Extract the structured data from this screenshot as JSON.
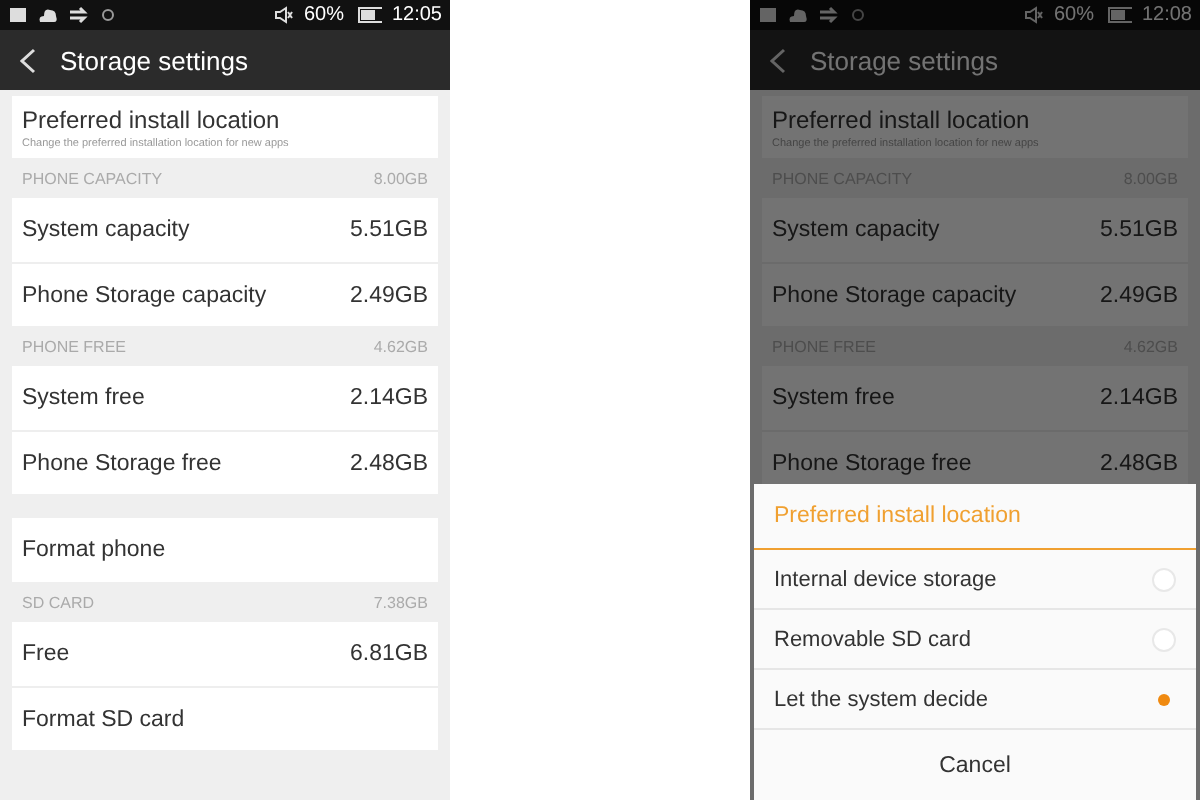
{
  "screens": [
    {
      "status_bar": {
        "battery": "60%",
        "time": "12:05"
      },
      "title": "Storage settings",
      "blocks": [
        {
          "kind": "link",
          "title": "Preferred install location",
          "subtitle": "Change the preferred installation location for new apps"
        },
        {
          "kind": "section",
          "label": "PHONE CAPACITY",
          "value": "8.00GB",
          "rows": [
            {
              "label": "System capacity",
              "value": "5.51GB"
            },
            {
              "label": "Phone Storage capacity",
              "value": "2.49GB"
            }
          ]
        },
        {
          "kind": "section",
          "label": "PHONE FREE",
          "value": "4.62GB",
          "rows": [
            {
              "label": "System free",
              "value": "2.14GB"
            },
            {
              "label": "Phone Storage free",
              "value": "2.48GB"
            }
          ]
        },
        {
          "kind": "group",
          "rows": [
            {
              "label": "Format phone"
            }
          ]
        },
        {
          "kind": "section",
          "label": "SD CARD",
          "value": "7.38GB",
          "rows": [
            {
              "label": "Free",
              "value": "6.81GB"
            },
            {
              "label": "Format SD card"
            }
          ]
        }
      ]
    },
    {
      "status_bar": {
        "battery": "60%",
        "time": "12:08"
      },
      "title": "Storage settings",
      "blocks": [
        {
          "kind": "link",
          "title": "Preferred install location",
          "subtitle": "Change the preferred installation location for new apps"
        },
        {
          "kind": "section",
          "label": "PHONE CAPACITY",
          "value": "8.00GB",
          "rows": [
            {
              "label": "System capacity",
              "value": "5.51GB"
            },
            {
              "label": "Phone Storage capacity",
              "value": "2.49GB"
            }
          ]
        },
        {
          "kind": "section",
          "label": "PHONE FREE",
          "value": "4.62GB",
          "rows": [
            {
              "label": "System free",
              "value": "2.14GB"
            },
            {
              "label": "Phone Storage free",
              "value": "2.48GB"
            }
          ]
        }
      ],
      "dialog": {
        "title": "Preferred install location",
        "options": [
          {
            "label": "Internal device storage",
            "selected": false
          },
          {
            "label": "Removable SD card",
            "selected": false
          },
          {
            "label": "Let the system decide",
            "selected": true
          }
        ],
        "cancel": "Cancel"
      }
    }
  ]
}
